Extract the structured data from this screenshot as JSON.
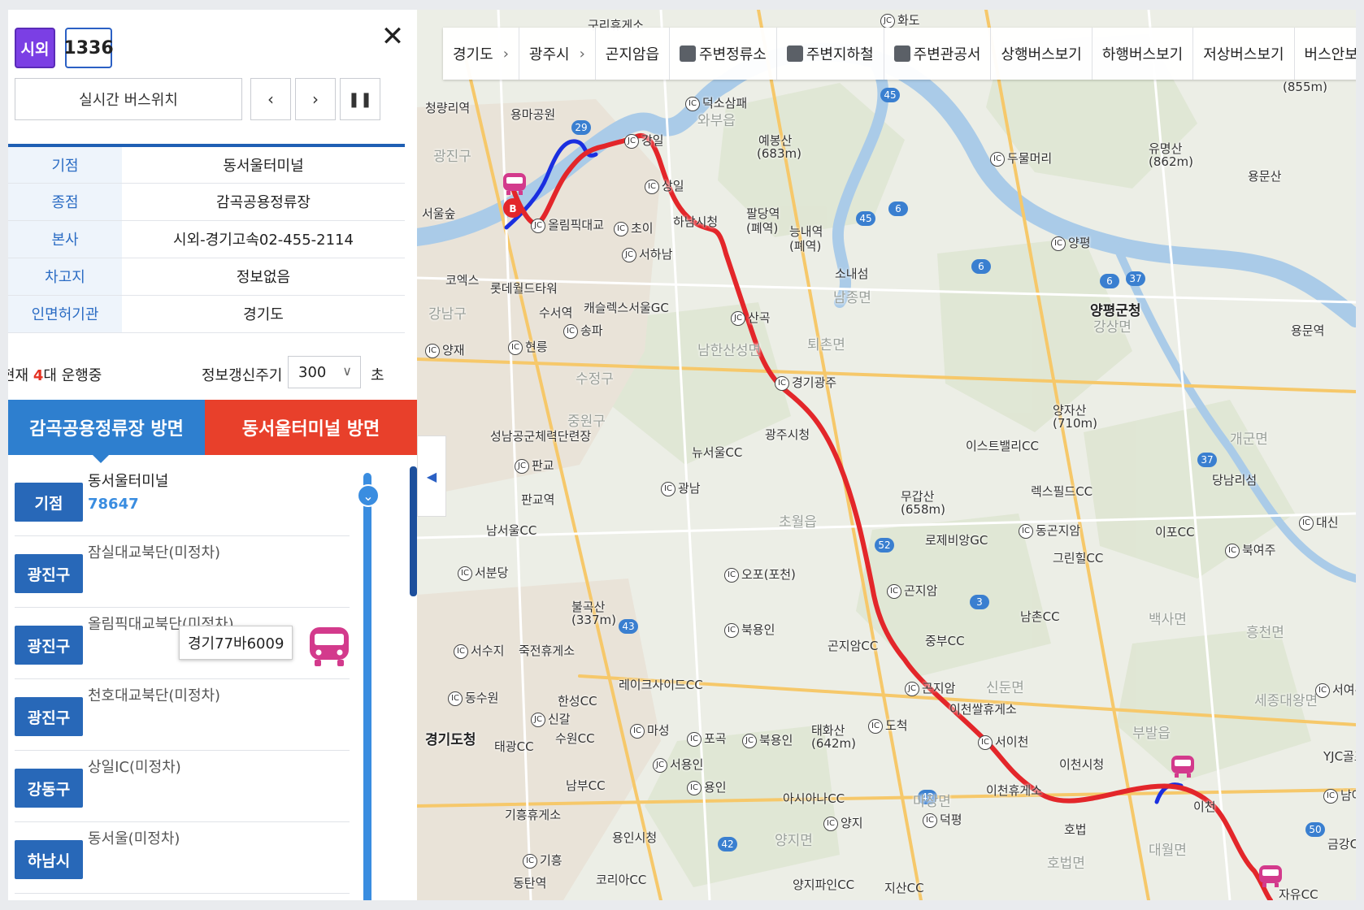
{
  "route": {
    "type_label": "시외",
    "number": "1336"
  },
  "controls": {
    "realtime_label": "실시간 버스위치",
    "prev_label": "‹",
    "next_label": "›",
    "pause_label": "❚❚",
    "close_label": "✕"
  },
  "info": {
    "rows": [
      {
        "label": "기점",
        "value": "동서울터미널"
      },
      {
        "label": "종점",
        "value": "감곡공용정류장"
      },
      {
        "label": "본사",
        "value": "시외-경기고속02-455-2114"
      },
      {
        "label": "차고지",
        "value": "정보없음"
      },
      {
        "label": "인면허기관",
        "value": "경기도"
      }
    ]
  },
  "status": {
    "prefix": "현재 ",
    "count": "4",
    "suffix": "대 운행중",
    "refresh_label": "정보갱신주기",
    "refresh_value": "300",
    "refresh_unit": "초"
  },
  "directions": [
    "감곡공용정류장 방면",
    "동서울터미널 방면"
  ],
  "stops": [
    {
      "district": "기점",
      "name": "동서울터미널",
      "number": "78647"
    },
    {
      "district": "광진구",
      "name": "잠실대교북단(미정차)"
    },
    {
      "district": "광진구",
      "name": "올림픽대교북단(미정차)"
    },
    {
      "district": "광진구",
      "name": "천호대교북단(미정차)"
    },
    {
      "district": "강동구",
      "name": "상일IC(미정차)"
    },
    {
      "district": "하남시",
      "name": "동서울(미정차)"
    }
  ],
  "bus_plate": "경기77바6009",
  "map": {
    "nav": [
      "경기도",
      "광주시",
      "곤지암읍",
      "주변정류소",
      "주변지하철",
      "주변관공서",
      "상행버스보기",
      "하행버스보기",
      "저상버스보기",
      "버스안보기"
    ],
    "labels": {
      "l01": "구리휴게소",
      "l02": "화도",
      "l03": "덕소삼패",
      "l04": "와부읍",
      "l05": "예봉산",
      "l06": "(683m)",
      "l07": "청량리역",
      "l08": "용마공원",
      "l09": "강일",
      "l10": "상일",
      "l11": "두물머리",
      "l12": "유명산",
      "l13": "(862m)",
      "l14": "(855m)",
      "l15": "용문산",
      "l16": "하남시청",
      "l17": "팔당역",
      "l18": "(폐역)",
      "l19": "능내역",
      "l20": "(폐역)",
      "l21": "올림픽대교",
      "l22": "초이",
      "l23": "서하남",
      "l24": "소내섬",
      "l25": "남종면",
      "l26": "양평",
      "l27": "코엑스",
      "l28": "롯데월드타워",
      "l29": "캐슬렉스서울GC",
      "l30": "수서역",
      "l31": "송파",
      "l32": "산곡",
      "l33": "양평군청",
      "l34": "강상면",
      "l35": "용문역",
      "l36": "양재",
      "l37": "현릉",
      "l38": "남한산성면",
      "l39": "퇴촌면",
      "l40": "경기광주",
      "l41": "수정구",
      "l42": "중원구",
      "l43": "성남공군체력단련장",
      "l44": "뉴서울CC",
      "l45": "광주시청",
      "l46": "양자산",
      "l47": "(710m)",
      "l48": "이스트밸리CC",
      "l49": "판교",
      "l50": "판교역",
      "l51": "광남",
      "l52": "무갑산",
      "l53": "(658m)",
      "l54": "렉스필드CC",
      "l55": "개군면",
      "l56": "당남리섬",
      "l57": "남서울CC",
      "l58": "초월읍",
      "l59": "로제비앙GC",
      "l60": "동곤지암",
      "l61": "이포CC",
      "l62": "대신",
      "l63": "북여주",
      "l64": "서분당",
      "l65": "오포(포천)",
      "l66": "그린힐CC",
      "l67": "곤지암",
      "l68": "남촌CC",
      "l69": "불곡산",
      "l70": "(337m)",
      "l71": "북용인",
      "l72": "곤지암CC",
      "l73": "중부CC",
      "l74": "백사면",
      "l75": "흥천면",
      "l76": "서수지",
      "l77": "죽전휴게소",
      "l78": "레이크사이드CC",
      "l79": "동수원",
      "l80": "한성CC",
      "l81": "신갈",
      "l82": "곤지암",
      "l83": "신둔면",
      "l84": "이천쌀휴게소",
      "l85": "세종대왕면",
      "l86": "서여주",
      "l87": "경기도청",
      "l88": "태광CC",
      "l89": "수원CC",
      "l90": "마성",
      "l91": "포곡",
      "l92": "북용인",
      "l93": "태화산",
      "l94": "(642m)",
      "l95": "도척",
      "l96": "서이천",
      "l97": "이천시청",
      "l98": "부발읍",
      "l99": "YJC골프",
      "l100": "서용인",
      "l101": "남부CC",
      "l102": "용인",
      "l103": "아시아나CC",
      "l104": "마장면",
      "l105": "이천휴게소",
      "l106": "덕평",
      "l107": "호법",
      "l108": "이천",
      "l109": "남여주",
      "l110": "기흥휴게소",
      "l111": "용인시청",
      "l112": "양지면",
      "l113": "양지",
      "l114": "호법면",
      "l115": "대월면",
      "l116": "금강C",
      "l117": "기흥",
      "l118": "동탄역",
      "l119": "코리아CC",
      "l120": "양지파인CC",
      "l121": "지산CC",
      "l122": "자유CC",
      "l123": "서울숲",
      "l124": "광진구",
      "l125": "강남구"
    }
  },
  "colors": {
    "accent_blue": "#2e7fcf",
    "accent_red": "#e8402b",
    "route_red": "#e3262a",
    "route_blue": "#1a2fe0",
    "bus_pink": "#d33a8c",
    "badge_purple": "#7b3fe4"
  }
}
